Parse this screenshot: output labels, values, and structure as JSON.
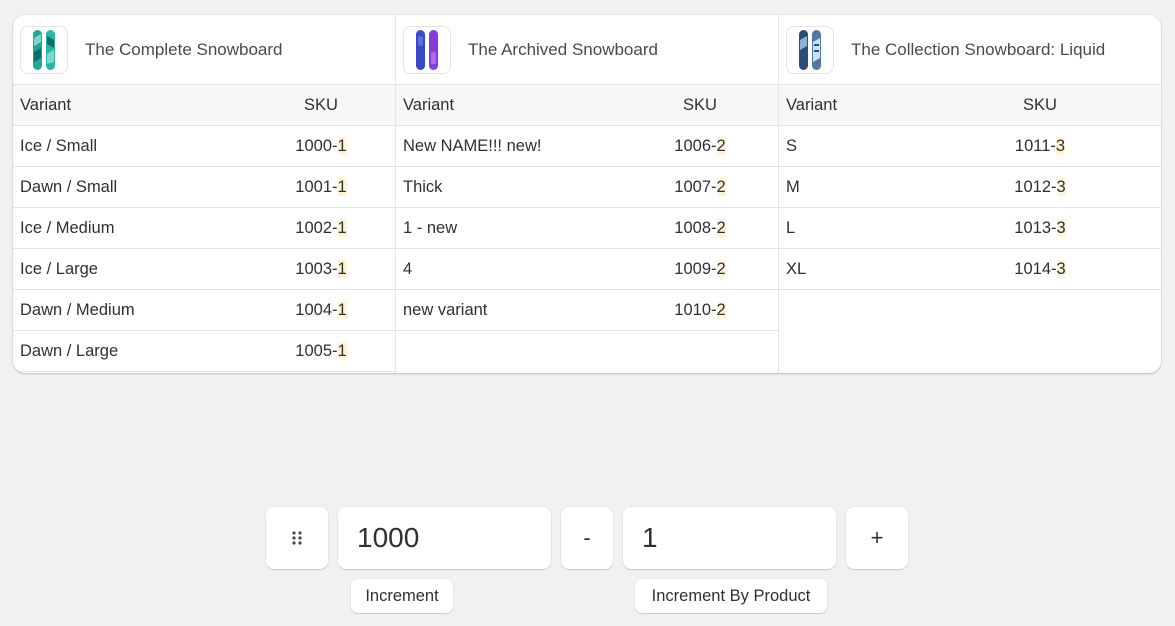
{
  "products": [
    {
      "title": "The Complete Snowboard",
      "thumb_colors": [
        "#1fa89a",
        "#7fd8c9"
      ],
      "headers": {
        "variant": "Variant",
        "sku": "SKU"
      },
      "rows": [
        {
          "variant": "Ice / Small",
          "sku": "1000-",
          "sku_suffix": "1"
        },
        {
          "variant": "Dawn / Small",
          "sku": "1001-",
          "sku_suffix": "1"
        },
        {
          "variant": "Ice / Medium",
          "sku": "1002-",
          "sku_suffix": "1"
        },
        {
          "variant": "Ice / Large",
          "sku": "1003-",
          "sku_suffix": "1"
        },
        {
          "variant": "Dawn / Medium",
          "sku": "1004-",
          "sku_suffix": "1"
        },
        {
          "variant": "Dawn / Large",
          "sku": "1005-",
          "sku_suffix": "1"
        }
      ]
    },
    {
      "title": "The Archived Snowboard",
      "thumb_colors": [
        "#3848c8",
        "#8a3ad8"
      ],
      "headers": {
        "variant": "Variant",
        "sku": "SKU"
      },
      "rows": [
        {
          "variant": "New NAME!!! new!",
          "sku": "1006-",
          "sku_suffix": "2"
        },
        {
          "variant": "Thick",
          "sku": "1007-",
          "sku_suffix": "2"
        },
        {
          "variant": "1 - new",
          "sku": "1008-",
          "sku_suffix": "2"
        },
        {
          "variant": "4",
          "sku": "1009-",
          "sku_suffix": "2"
        },
        {
          "variant": "new variant",
          "sku": "1010-",
          "sku_suffix": "2"
        }
      ]
    },
    {
      "title": "The Collection Snowboard: Liquid",
      "thumb_colors": [
        "#2a4e7a",
        "#8fb2d2"
      ],
      "headers": {
        "variant": "Variant",
        "sku": "SKU"
      },
      "rows": [
        {
          "variant": "S",
          "sku": "1011-",
          "sku_suffix": "3"
        },
        {
          "variant": "M",
          "sku": "1012-",
          "sku_suffix": "3"
        },
        {
          "variant": "L",
          "sku": "1013-",
          "sku_suffix": "3"
        },
        {
          "variant": "XL",
          "sku": "1014-",
          "sku_suffix": "3"
        }
      ]
    }
  ],
  "controls": {
    "handle_icon": "drag-handle-icon",
    "increment_value": "1000",
    "minus_label": "-",
    "increment_by_product_value": "1",
    "plus_label": "+",
    "increment_label": "Increment",
    "increment_by_product_label": "Increment By Product"
  },
  "colors": {
    "highlight": "#fff4d6",
    "background": "#f1f1f1",
    "border": "#e3e3e3"
  }
}
